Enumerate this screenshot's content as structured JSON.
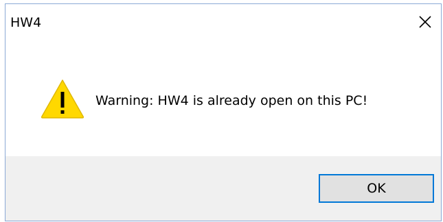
{
  "window": {
    "title": "HW4"
  },
  "message": {
    "text": "Warning: HW4 is already open on this PC!"
  },
  "buttons": {
    "ok_label": "OK"
  },
  "icons": {
    "warning": "warning-triangle-icon",
    "close": "close-icon"
  },
  "colors": {
    "accent": "#0078d7",
    "warning_yellow": "#ffd800",
    "footer_bg": "#f0f0f0"
  }
}
